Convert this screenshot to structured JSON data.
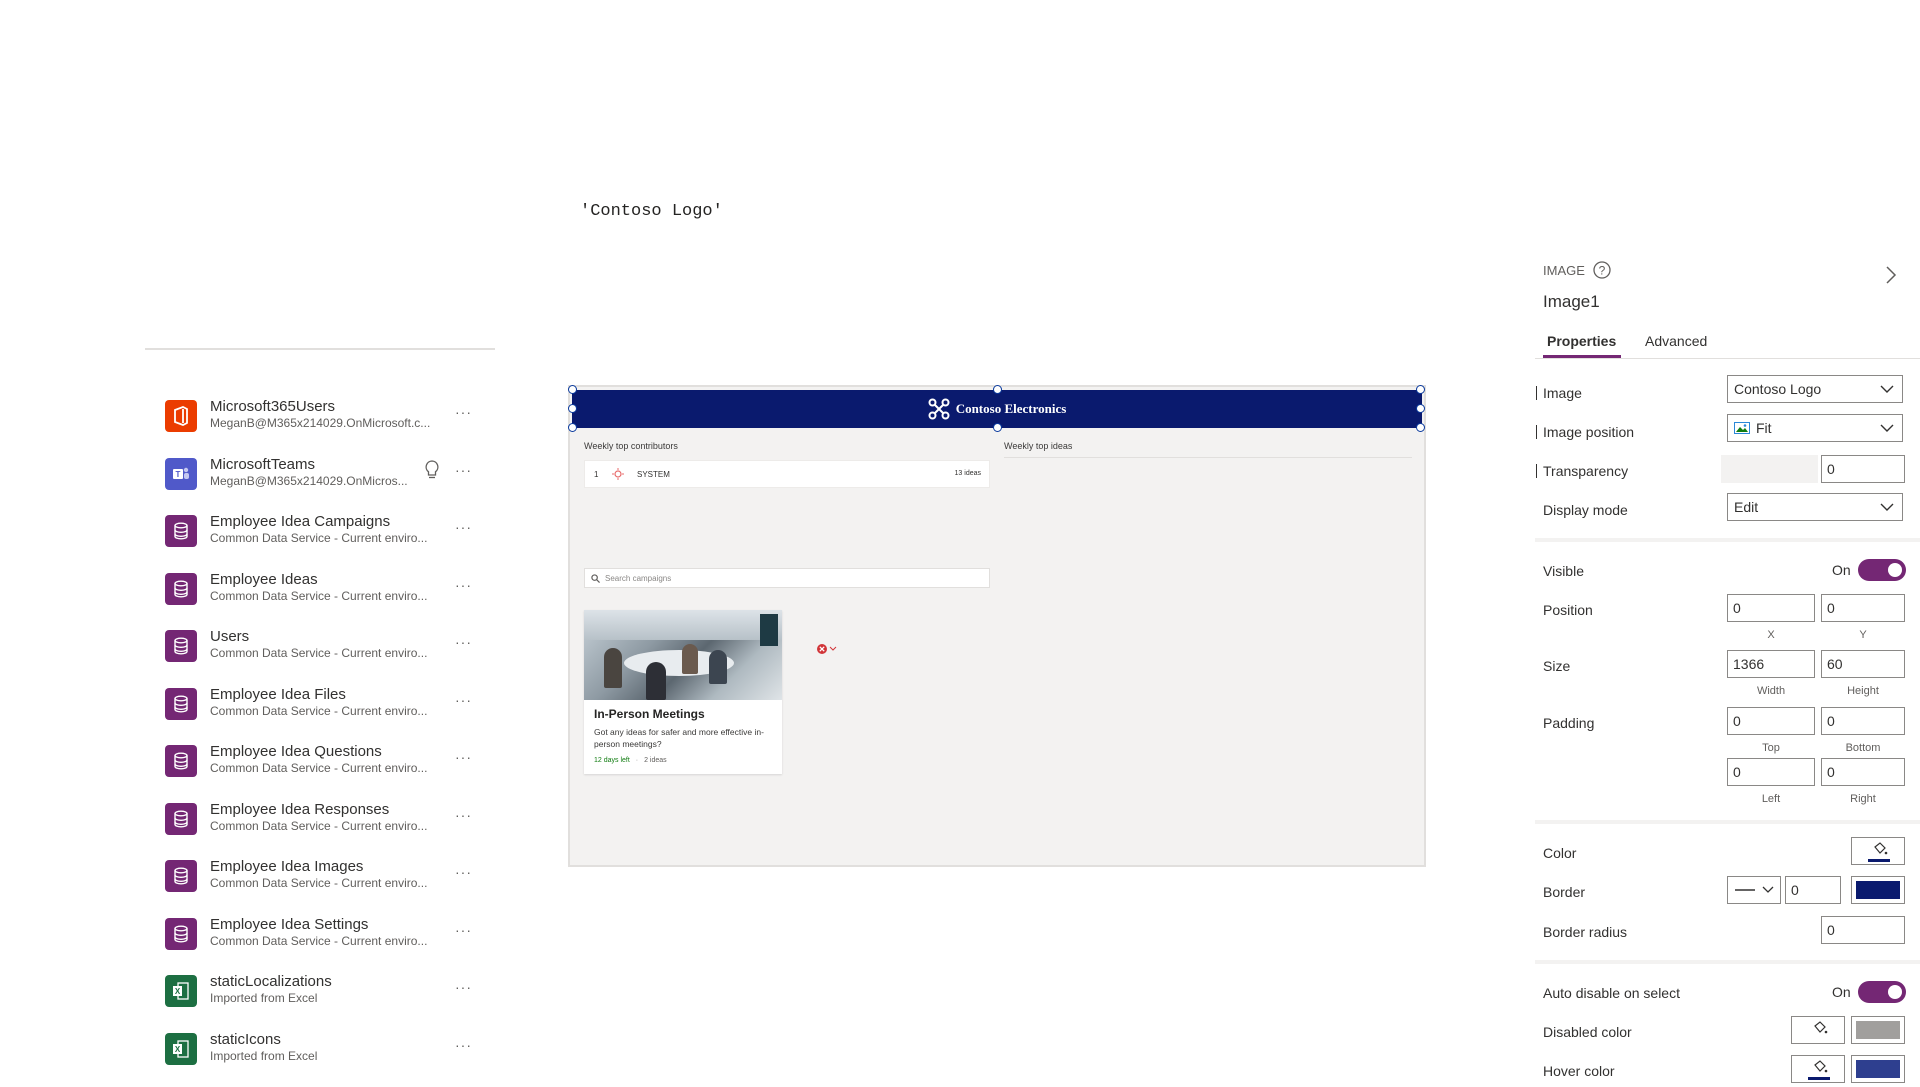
{
  "formula": "'Contoso Logo'",
  "data_sources": [
    {
      "name": "Microsoft365Users",
      "subtitle": "MeganB@M365x214029.OnMicrosoft.c...",
      "icon": "office-icon",
      "color": "#eb3c00"
    },
    {
      "name": "MicrosoftTeams",
      "subtitle": "MeganB@M365x214029.OnMicros...",
      "icon": "teams-icon",
      "color": "#5059c9"
    },
    {
      "name": "Employee Idea Campaigns",
      "subtitle": "Common Data Service - Current enviro...",
      "icon": "database-icon",
      "color": "#742774"
    },
    {
      "name": "Employee Ideas",
      "subtitle": "Common Data Service - Current enviro...",
      "icon": "database-icon",
      "color": "#742774"
    },
    {
      "name": "Users",
      "subtitle": "Common Data Service - Current enviro...",
      "icon": "database-icon",
      "color": "#742774"
    },
    {
      "name": "Employee Idea Files",
      "subtitle": "Common Data Service - Current enviro...",
      "icon": "database-icon",
      "color": "#742774"
    },
    {
      "name": "Employee Idea Questions",
      "subtitle": "Common Data Service - Current enviro...",
      "icon": "database-icon",
      "color": "#742774"
    },
    {
      "name": "Employee Idea Responses",
      "subtitle": "Common Data Service - Current enviro...",
      "icon": "database-icon",
      "color": "#742774"
    },
    {
      "name": "Employee Idea Images",
      "subtitle": "Common Data Service - Current enviro...",
      "icon": "database-icon",
      "color": "#742774"
    },
    {
      "name": "Employee Idea Settings",
      "subtitle": "Common Data Service - Current enviro...",
      "icon": "database-icon",
      "color": "#742774"
    },
    {
      "name": "staticLocalizations",
      "subtitle": "Imported from Excel",
      "icon": "excel-icon",
      "color": "#1d6f42"
    },
    {
      "name": "staticIcons",
      "subtitle": "Imported from Excel",
      "icon": "excel-icon",
      "color": "#1d6f42"
    }
  ],
  "more_label": "···",
  "canvas": {
    "header_title": "Contoso Electronics",
    "header_color": "#0a1a6e",
    "weekly_contributors_title": "Weekly top contributors",
    "weekly_ideas_title": "Weekly top ideas",
    "contributor": {
      "rank": "1",
      "name": "SYSTEM",
      "count": "13 ideas"
    },
    "search_placeholder": "Search campaigns",
    "card": {
      "title": "In-Person Meetings",
      "description": "Got any ideas for safer and more effective in-person meetings?",
      "days_left": "12 days left",
      "ideas": "2 ideas"
    }
  },
  "properties": {
    "control_type": "IMAGE",
    "control_name": "Image1",
    "tabs": [
      "Properties",
      "Advanced"
    ],
    "image_label": "Image",
    "image_value": "Contoso Logo",
    "image_position_label": "Image position",
    "image_position_value": "Fit",
    "transparency_label": "Transparency",
    "transparency_value": "0",
    "display_mode_label": "Display mode",
    "display_mode_value": "Edit",
    "visible_label": "Visible",
    "visible_value": "On",
    "position_label": "Position",
    "position_x": "0",
    "position_y": "0",
    "x_caption": "X",
    "y_caption": "Y",
    "size_label": "Size",
    "size_width": "1366",
    "size_height": "60",
    "width_caption": "Width",
    "height_caption": "Height",
    "padding_label": "Padding",
    "padding_top": "0",
    "padding_bottom": "0",
    "padding_left": "0",
    "padding_right": "0",
    "top_caption": "Top",
    "bottom_caption": "Bottom",
    "left_caption": "Left",
    "right_caption": "Right",
    "color_label": "Color",
    "border_label": "Border",
    "border_width": "0",
    "border_color": "#0a1a6e",
    "border_radius_label": "Border radius",
    "border_radius_value": "0",
    "auto_disable_label": "Auto disable on select",
    "auto_disable_value": "On",
    "disabled_color_label": "Disabled color",
    "disabled_color": "#a19f9d",
    "hover_color_label": "Hover color",
    "hover_color": "#2e3f8f",
    "accent": "#742774"
  }
}
